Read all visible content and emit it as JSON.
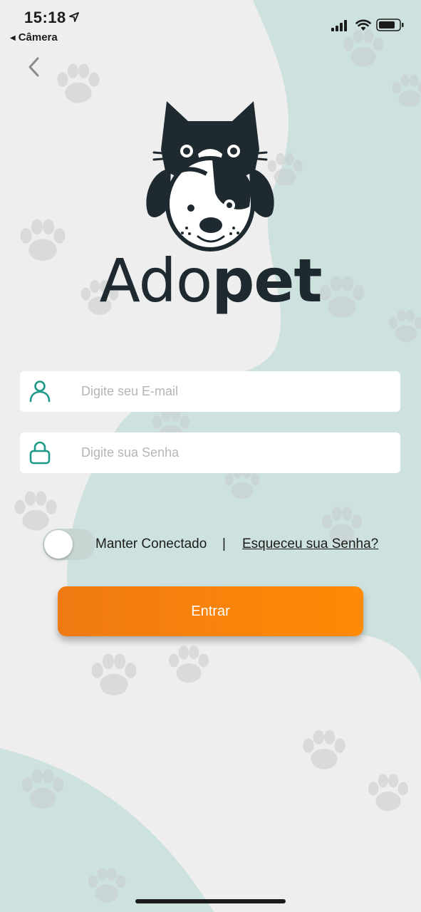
{
  "status_bar": {
    "time": "15:18",
    "back_app": "Câmera",
    "icons": [
      "location-arrow-icon",
      "cellular-signal-icon",
      "wifi-icon",
      "battery-icon"
    ]
  },
  "navigation": {
    "back_icon": "chevron-left-icon"
  },
  "brand": {
    "part_light": "Ado",
    "part_bold": "pet",
    "logo_icon": "cat-and-dog-icon"
  },
  "form": {
    "email": {
      "placeholder": "Digite seu E-mail",
      "value": "",
      "icon": "user-icon"
    },
    "password": {
      "placeholder": "Digite sua Senha",
      "value": "",
      "icon": "lock-icon"
    },
    "keep_connected": {
      "label": "Manter Conectado",
      "checked": false
    },
    "separator": "|",
    "forgot_password": "Esqueceu sua Senha?",
    "submit": "Entrar"
  },
  "colors": {
    "accent_teal": "#1e9b88",
    "button_orange": "#f7820a",
    "background": "#eeeeee",
    "blob": "#cde2df",
    "dark": "#1e2a30"
  }
}
